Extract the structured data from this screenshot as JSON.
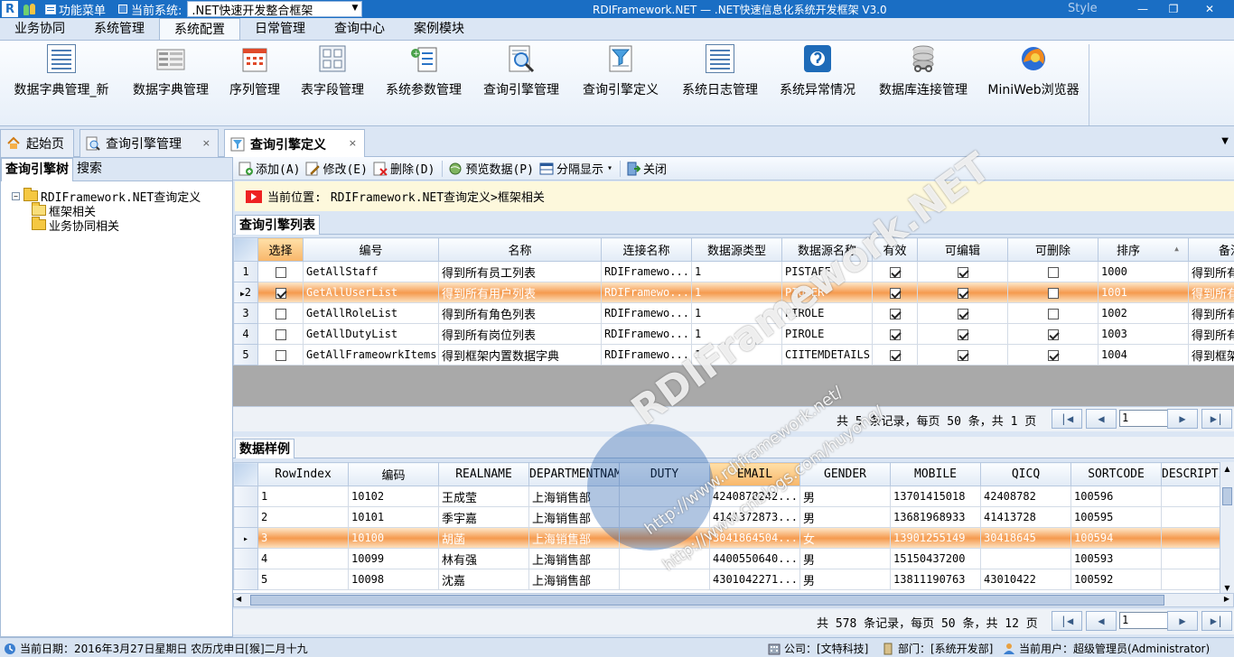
{
  "titlebar": {
    "logo": "R",
    "menu_label": "功能菜单",
    "current_system_label": "当前系统:",
    "current_system_value": ".NET快速开发整合框架",
    "window_title": "RDIFramework.NET — .NET快速信息化系统开发框架 V3.0",
    "style_label": "Style",
    "minimize": "—",
    "maximize": "❐",
    "close": "✕"
  },
  "ribbon": {
    "tabs": [
      "业务协同",
      "系统管理",
      "系统配置",
      "日常管理",
      "查询中心",
      "案例模块"
    ],
    "active_tab": 2,
    "buttons": [
      {
        "label": "数据字典管理_新",
        "icon": "document-list-icon"
      },
      {
        "label": "数据字典管理",
        "icon": "dictionary-icon"
      },
      {
        "label": "序列管理",
        "icon": "calendar-icon"
      },
      {
        "label": "表字段管理",
        "icon": "table-fields-icon"
      },
      {
        "label": "系统参数管理",
        "icon": "parameter-icon"
      },
      {
        "label": "查询引擎管理",
        "icon": "magnifier-document-icon"
      },
      {
        "label": "查询引擎定义",
        "icon": "filter-icon"
      },
      {
        "label": "系统日志管理",
        "icon": "log-icon"
      },
      {
        "label": "系统异常情况",
        "icon": "exception-icon"
      },
      {
        "label": "数据库连接管理",
        "icon": "database-icon"
      },
      {
        "label": "MiniWeb浏览器",
        "icon": "browser-icon"
      }
    ]
  },
  "doctabs": {
    "home": "起始页",
    "tab1": "查询引擎管理",
    "tab2": "查询引擎定义",
    "close": "×",
    "dropdown": "▼"
  },
  "leftpanel": {
    "tab_tree": "查询引擎树",
    "tab_search": "搜索",
    "root": "RDIFramework.NET查询定义",
    "expander": "−",
    "children": [
      "框架相关",
      "业务协同相关"
    ]
  },
  "toolbar": {
    "add": "添加(A)",
    "edit": "修改(E)",
    "delete": "删除(D)",
    "preview": "预览数据(P)",
    "split": "分隔显示",
    "split_arrow": "▾",
    "close": "关闭"
  },
  "location": {
    "label": "当前位置:",
    "path": "RDIFramework.NET查询定义>框架相关"
  },
  "engine_list": {
    "title": "查询引擎列表",
    "columns": [
      "选择",
      "编号",
      "名称",
      "连接名称",
      "数据源类型",
      "数据源名称",
      "有效",
      "可编辑",
      "可删除",
      "排序",
      "备注"
    ],
    "sort_arrow": "▲",
    "rows": [
      {
        "n": "1",
        "sel": false,
        "code": "GetAllStaff",
        "name": "得到所有员工列表",
        "conn": "RDIFramewo...",
        "dstype": "1",
        "dsname": "PISTAFF",
        "valid": true,
        "editable": true,
        "deletable": false,
        "sort": "1000",
        "remark": "得到所有"
      },
      {
        "n": "2",
        "sel": true,
        "code": "GetAllUserList",
        "name": "得到所有用户列表",
        "conn": "RDIFramewo...",
        "dstype": "1",
        "dsname": "PIUSER",
        "valid": true,
        "editable": true,
        "deletable": false,
        "sort": "1001",
        "remark": "得到所有"
      },
      {
        "n": "3",
        "sel": false,
        "code": "GetAllRoleList",
        "name": "得到所有角色列表",
        "conn": "RDIFramewo...",
        "dstype": "1",
        "dsname": "PIROLE",
        "valid": true,
        "editable": true,
        "deletable": false,
        "sort": "1002",
        "remark": "得到所有"
      },
      {
        "n": "4",
        "sel": false,
        "code": "GetAllDutyList",
        "name": "得到所有岗位列表",
        "conn": "RDIFramewo...",
        "dstype": "1",
        "dsname": "PIROLE",
        "valid": true,
        "editable": true,
        "deletable": true,
        "sort": "1003",
        "remark": "得到所有"
      },
      {
        "n": "5",
        "sel": false,
        "code": "GetAllFrameowrkItems",
        "name": "得到框架内置数据字典",
        "conn": "RDIFramewo...",
        "dstype": "1",
        "dsname": "CIITEMDETAILS",
        "valid": true,
        "editable": true,
        "deletable": true,
        "sort": "1004",
        "remark": "得到框架"
      }
    ],
    "pager_text": "共 5 条记录，每页 50 条，共 1 页",
    "page_value": "1"
  },
  "sample": {
    "title": "数据样例",
    "columns": [
      "RowIndex",
      "编码",
      "REALNAME",
      "DEPARTMENTNAME",
      "DUTY",
      "EMAIL",
      "GENDER",
      "MOBILE",
      "QICQ",
      "SORTCODE",
      "DESCRIPTION"
    ],
    "rows": [
      {
        "n": "",
        "ri": "1",
        "code": "10102",
        "name": "王成莹",
        "dept": "上海销售部",
        "duty": "",
        "email": "4240878242...",
        "gender": "男",
        "mobile": "13701415018",
        "qq": "42408782",
        "sort": "100596"
      },
      {
        "n": "",
        "ri": "2",
        "code": "10101",
        "name": "季宇嘉",
        "dept": "上海销售部",
        "duty": "",
        "email": "4141372873...",
        "gender": "男",
        "mobile": "13681968933",
        "qq": "41413728",
        "sort": "100595"
      },
      {
        "n": "▸",
        "ri": "3",
        "code": "10100",
        "name": "胡菡",
        "dept": "上海销售部",
        "duty": "",
        "email": "3041864504...",
        "gender": "女",
        "mobile": "13901255149",
        "qq": "30418645",
        "sort": "100594"
      },
      {
        "n": "",
        "ri": "4",
        "code": "10099",
        "name": "林有强",
        "dept": "上海销售部",
        "duty": "",
        "email": "4400550640...",
        "gender": "男",
        "mobile": "15150437200",
        "qq": "",
        "sort": "100593"
      },
      {
        "n": "",
        "ri": "5",
        "code": "10098",
        "name": "沈嘉",
        "dept": "上海销售部",
        "duty": "",
        "email": "4301042271...",
        "gender": "男",
        "mobile": "13811190763",
        "qq": "43010422",
        "sort": "100592"
      }
    ],
    "pager_text": "共 578 条记录，每页 50 条，共 12 页",
    "page_value": "1"
  },
  "pager_buttons": {
    "first": "|◀",
    "prev": "◀",
    "next": "▶",
    "last": "▶|"
  },
  "watermark": {
    "brand": "RDIFramework.NET",
    "url1": "http://www.rdiframework.net/",
    "url2": "http://www.cnblogs.com/huyong/"
  },
  "status": {
    "date": "当前日期：2016年3月27日星期日 农历戊申日[猴]二月十九",
    "company": "公司：[文特科技]",
    "dept": "部门：[系统开发部]",
    "user": "当前用户：超级管理员(Administrator)"
  },
  "colors": {
    "titlebar": "#1a6ec4",
    "highlight": "#f59a4e",
    "location_bg": "#fdf8dc"
  }
}
